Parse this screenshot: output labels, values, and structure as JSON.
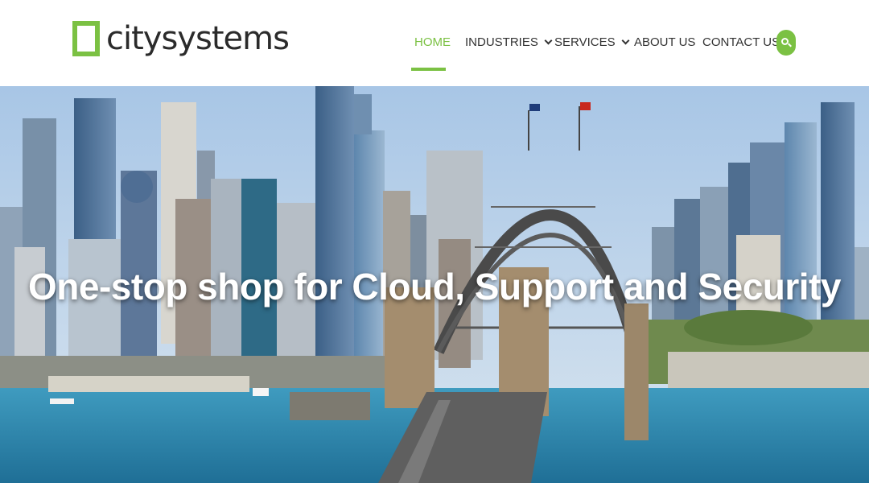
{
  "brand": {
    "name": "citysystems",
    "accent_color": "#7bc143"
  },
  "nav": {
    "items": [
      {
        "label": "HOME",
        "active": true,
        "has_dropdown": false
      },
      {
        "label": "INDUSTRIES",
        "active": false,
        "has_dropdown": true
      },
      {
        "label": "SERVICES",
        "active": false,
        "has_dropdown": true
      },
      {
        "label": "ABOUT US",
        "active": false,
        "has_dropdown": false
      },
      {
        "label": "CONTACT US",
        "active": false,
        "has_dropdown": false
      }
    ],
    "search_icon": "search-icon"
  },
  "hero": {
    "title": "One-stop shop for Cloud, Support and Security",
    "image": "sydney-harbour-bridge-skyline"
  }
}
